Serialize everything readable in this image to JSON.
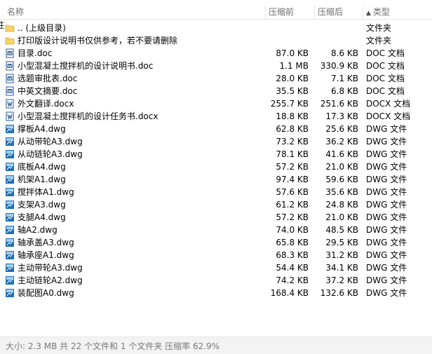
{
  "columns": {
    "name": "名称",
    "packed": "压缩前",
    "original": "压缩后",
    "type": "类型",
    "sort_indicator": "▲"
  },
  "edge_char": "驻",
  "files": [
    {
      "name": ".. (上级目录)",
      "packed": "",
      "original": "",
      "type": "文件夹",
      "icon": "folder-icon"
    },
    {
      "name": "打印版设计说明书仅供参考，若不要请删除",
      "packed": "",
      "original": "",
      "type": "文件夹",
      "icon": "folder-icon"
    },
    {
      "name": "目录.doc",
      "packed": "87.0 KB",
      "original": "8.6 KB",
      "type": "DOC 文档",
      "icon": "doc-icon"
    },
    {
      "name": "小型混凝土搅拌机的设计说明书.doc",
      "packed": "1.1 MB",
      "original": "330.9 KB",
      "type": "DOC 文档",
      "icon": "doc-icon"
    },
    {
      "name": "选题审批表.doc",
      "packed": "28.0 KB",
      "original": "7.1 KB",
      "type": "DOC 文档",
      "icon": "doc-icon"
    },
    {
      "name": "中英文摘要.doc",
      "packed": "35.5 KB",
      "original": "6.8 KB",
      "type": "DOC 文档",
      "icon": "doc-icon"
    },
    {
      "name": "外文翻译.docx",
      "packed": "255.7 KB",
      "original": "251.6 KB",
      "type": "DOCX 文档",
      "icon": "docx-icon"
    },
    {
      "name": "小型混凝土搅拌机的设计任务书.docx",
      "packed": "18.8 KB",
      "original": "17.3 KB",
      "type": "DOCX 文档",
      "icon": "docx-icon"
    },
    {
      "name": "撑板A4.dwg",
      "packed": "62.8 KB",
      "original": "25.6 KB",
      "type": "DWG 文件",
      "icon": "dwg-icon"
    },
    {
      "name": "从动带轮A3.dwg",
      "packed": "73.2 KB",
      "original": "36.2 KB",
      "type": "DWG 文件",
      "icon": "dwg-icon"
    },
    {
      "name": "从动链轮A3.dwg",
      "packed": "78.1 KB",
      "original": "41.6 KB",
      "type": "DWG 文件",
      "icon": "dwg-icon"
    },
    {
      "name": "底板A4.dwg",
      "packed": "57.2 KB",
      "original": "21.0 KB",
      "type": "DWG 文件",
      "icon": "dwg-icon"
    },
    {
      "name": "机架A1.dwg",
      "packed": "97.4 KB",
      "original": "59.6 KB",
      "type": "DWG 文件",
      "icon": "dwg-icon"
    },
    {
      "name": "搅拌体A1.dwg",
      "packed": "57.6 KB",
      "original": "35.6 KB",
      "type": "DWG 文件",
      "icon": "dwg-icon"
    },
    {
      "name": "支架A3.dwg",
      "packed": "61.2 KB",
      "original": "24.8 KB",
      "type": "DWG 文件",
      "icon": "dwg-icon"
    },
    {
      "name": "支腿A4.dwg",
      "packed": "57.2 KB",
      "original": "21.0 KB",
      "type": "DWG 文件",
      "icon": "dwg-icon"
    },
    {
      "name": "轴A2.dwg",
      "packed": "74.0 KB",
      "original": "48.5 KB",
      "type": "DWG 文件",
      "icon": "dwg-icon"
    },
    {
      "name": "轴承盖A3.dwg",
      "packed": "65.8 KB",
      "original": "29.5 KB",
      "type": "DWG 文件",
      "icon": "dwg-icon"
    },
    {
      "name": "轴承座A1.dwg",
      "packed": "68.3 KB",
      "original": "31.2 KB",
      "type": "DWG 文件",
      "icon": "dwg-icon"
    },
    {
      "name": "主动带轮A3.dwg",
      "packed": "54.4 KB",
      "original": "34.1 KB",
      "type": "DWG 文件",
      "icon": "dwg-icon"
    },
    {
      "name": "主动链轮A2.dwg",
      "packed": "74.2 KB",
      "original": "37.2 KB",
      "type": "DWG 文件",
      "icon": "dwg-icon"
    },
    {
      "name": "装配图A0.dwg",
      "packed": "168.4 KB",
      "original": "132.6 KB",
      "type": "DWG 文件",
      "icon": "dwg-icon"
    }
  ],
  "status": {
    "text": "大小: 2.3 MB 共 22 个文件和 1 个文件夹 压缩率 62.9%"
  },
  "colors": {
    "folder": "#f5d36a",
    "doc": "#2b5797",
    "dwg": "#1f6fb6",
    "header_text": "#6d6d6d",
    "status_bg": "#f3f3f3"
  }
}
